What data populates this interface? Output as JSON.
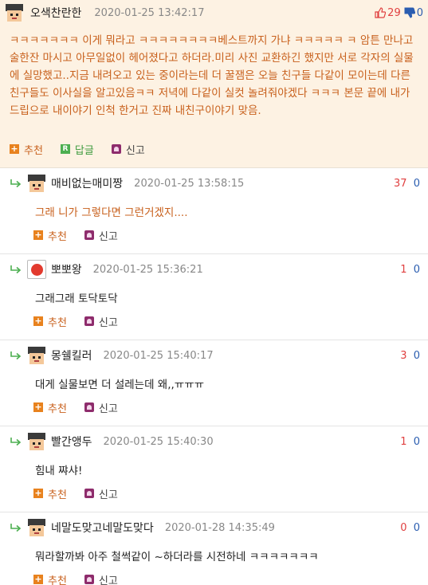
{
  "best": {
    "nick": "오색찬란한",
    "date": "2020-01-25 13:42:17",
    "up": "29",
    "down": "0",
    "text": "ㅋㅋㅋㅋㅋㅋㅋ 이게 뭐라고 ㅋㅋㅋㅋㅋㅋㅋㅋ베스트까지 가냐 ㅋㅋㅋㅋㅋ ㅋ 암튼 만나고 술한잔 마시고 아무일없이 헤어졌다고 하더라.미리 사진 교환하긴 했지만 서로 각자의 실물에 실망했고..지금 내려오고 있는 중이라는데 더 꿀잼은 오늘 친구들 다같이 모이는데 다른친구들도 이사실을 알고있음ㅋㅋ 저녁에 다같이 실컷 놀려줘야겠다 ㅋㅋㅋ 본문 끝에 내가 드립으로 내이야기 인척 한거고 진짜 내친구이야기 맞음.",
    "recommend": "추천",
    "reply": "답글",
    "report": "신고"
  },
  "replies": [
    {
      "nick": "매비없는매미짱",
      "date": "2020-01-25 13:58:15",
      "up": "37",
      "down": "0",
      "text": "그래 니가 그렇다면 그런거겠지....",
      "recommend": "추천",
      "report": "신고"
    },
    {
      "nick": "뽀뽀왕",
      "date": "2020-01-25 15:36:21",
      "up": "1",
      "down": "0",
      "text": "그래그래 토닥토닥",
      "recommend": "추천",
      "report": "신고"
    },
    {
      "nick": "몽쉘킬러",
      "date": "2020-01-25 15:40:17",
      "up": "3",
      "down": "0",
      "text": "대게 실물보면 더 설레는데 왜,,ㅠㅠㅠ",
      "recommend": "추천",
      "report": "신고"
    },
    {
      "nick": "빨간앵두",
      "date": "2020-01-25 15:40:30",
      "up": "1",
      "down": "0",
      "text": "힘내 쨔샤!",
      "recommend": "추천",
      "report": "신고"
    },
    {
      "nick": "네말도맞고네말도맞다",
      "date": "2020-01-28 14:35:49",
      "up": "0",
      "down": "0",
      "text": "뭐라할까봐 아주 철썩같이 ~하더라를 시전하네 ㅋㅋㅋㅋㅋㅋㅋ",
      "recommend": "추천",
      "report": "신고"
    }
  ],
  "icons": {
    "recommend": "plus-icon",
    "reply": "reply-r-icon",
    "report": "siren-icon",
    "thumb_up": "thumb-up-icon",
    "thumb_down": "thumb-down-icon",
    "reply_arrow": "reply-arrow-icon"
  },
  "colors": {
    "best_bg": "#fdf2e3",
    "accent_orange": "#c8601c",
    "up_red": "#e04040",
    "down_blue": "#2a5db0"
  }
}
